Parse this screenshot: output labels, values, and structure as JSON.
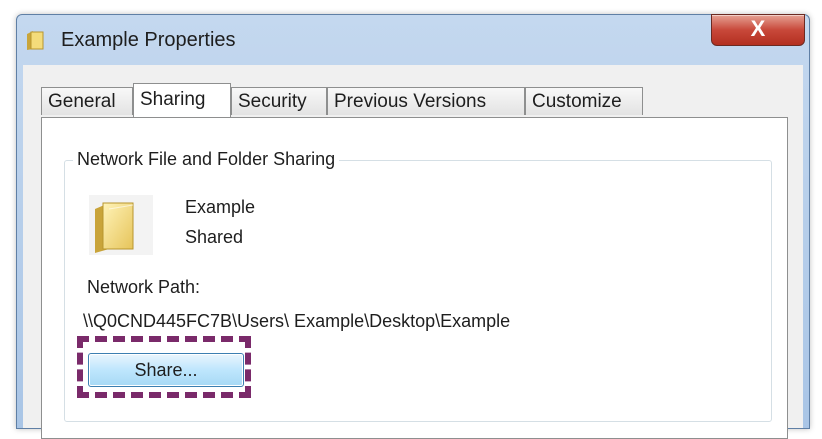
{
  "window": {
    "title": "Example Properties",
    "close_label": "X"
  },
  "tabs": [
    {
      "label": "General"
    },
    {
      "label": "Sharing",
      "active": true
    },
    {
      "label": "Security"
    },
    {
      "label": "Previous Versions"
    },
    {
      "label": "Customize"
    }
  ],
  "sharing": {
    "group_title": "Network File and Folder Sharing",
    "folder_name": "Example",
    "folder_state": "Shared",
    "network_path_label": "Network Path:",
    "network_path": "\\\\Q0CND445FC7B\\Users\\ Example\\Desktop\\Example",
    "share_button": "Share..."
  },
  "colors": {
    "highlight": "#7a2a6a",
    "button_border": "#3c7fb1",
    "close_button": "#c8483a"
  },
  "icons": [
    "folder-icon",
    "close-icon"
  ]
}
